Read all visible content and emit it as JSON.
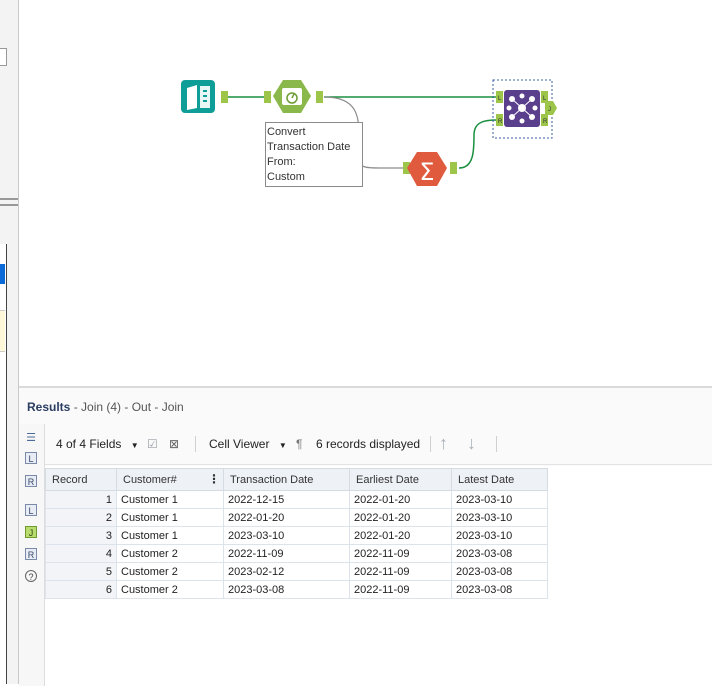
{
  "canvas": {
    "annotation": [
      "Convert",
      "Transaction Date",
      "From:",
      "Custom"
    ],
    "colors": {
      "connector": "#1a8f3e",
      "connector_gray": "#8c8c8c",
      "input_tool": "#0f9e97",
      "formula_tool": "#8ab84a",
      "summarize_tool": "#e05a3e",
      "join_tool": "#5a3f8c",
      "anchor": "#9cc54a"
    }
  },
  "results": {
    "title": "Results",
    "subtitle": "- Join (4) - Out - Join",
    "toolbar": {
      "fields_label": "4 of 4 Fields",
      "viewer_label": "Cell Viewer",
      "records_label": "6 records displayed"
    },
    "side_buttons": [
      "L",
      "R",
      "L",
      "J",
      "R",
      "?"
    ],
    "columns": [
      "Record",
      "Customer#",
      "Transaction Date",
      "Earliest Date",
      "Latest Date"
    ],
    "rows": [
      [
        "1",
        "Customer 1",
        "2022-12-15",
        "2022-01-20",
        "2023-03-10"
      ],
      [
        "2",
        "Customer 1",
        "2022-01-20",
        "2022-01-20",
        "2023-03-10"
      ],
      [
        "3",
        "Customer 1",
        "2023-03-10",
        "2022-01-20",
        "2023-03-10"
      ],
      [
        "4",
        "Customer 2",
        "2022-11-09",
        "2022-11-09",
        "2023-03-08"
      ],
      [
        "5",
        "Customer 2",
        "2023-02-12",
        "2022-11-09",
        "2023-03-08"
      ],
      [
        "6",
        "Customer 2",
        "2023-03-08",
        "2022-11-09",
        "2023-03-08"
      ]
    ]
  }
}
